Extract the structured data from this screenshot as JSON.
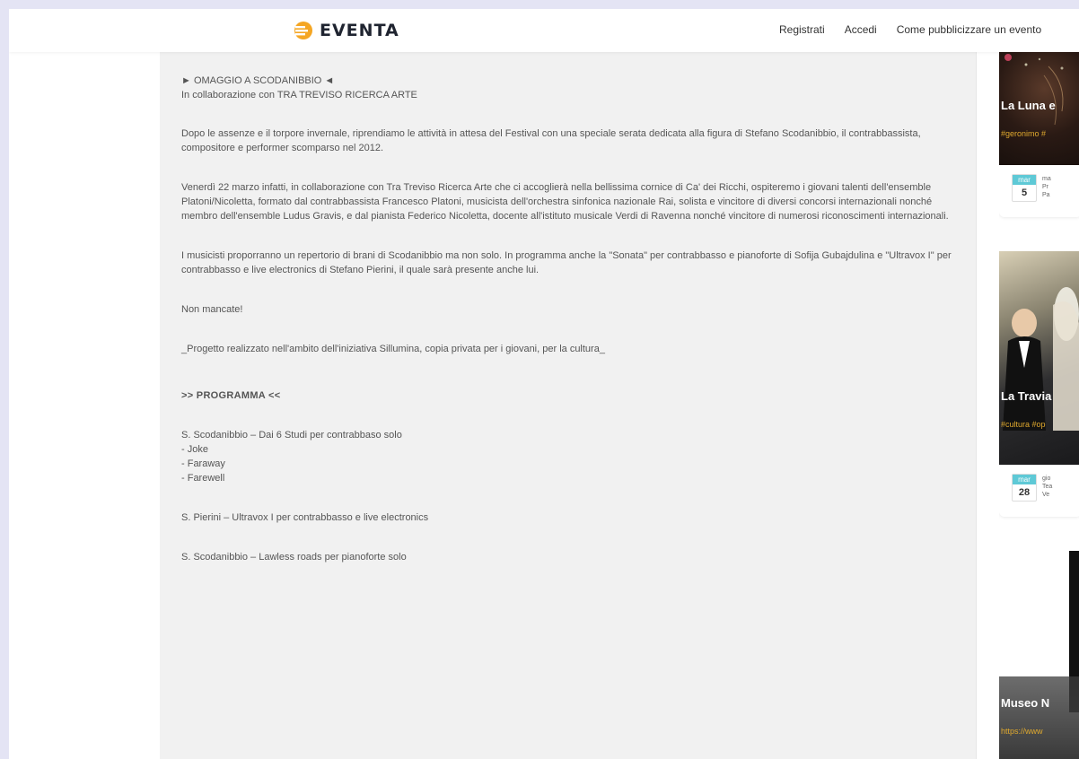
{
  "header": {
    "brand": "EVENTA",
    "nav": [
      "Registrati",
      "Accedi",
      "Come pubblicizzare un evento"
    ]
  },
  "article": {
    "title_line": "► OMAGGIO A SCODANIBBIO ◄",
    "collab_line": "In collaborazione con TRA TREVISO RICERCA ARTE",
    "para1": "Dopo le assenze e il torpore invernale, riprendiamo le attività in attesa del Festival con una speciale serata dedicata alla figura di Stefano Scodanibbio, il contrabbassista, compositore e performer scomparso nel 2012.",
    "para2": "Venerdì 22 marzo infatti, in collaborazione con Tra Treviso Ricerca Arte che ci accoglierà nella bellissima cornice di Ca' dei Ricchi, ospiteremo i giovani talenti dell'ensemble Platoni/Nicoletta, formato dal contrabbassista Francesco Platoni, musicista dell'orchestra sinfonica nazionale Rai, solista e vincitore di diversi concorsi internazionali nonché membro dell'ensemble Ludus Gravis, e dal pianista Federico Nicoletta, docente all'istituto musicale Verdi di Ravenna nonché vincitore di numerosi riconoscimenti internazionali.",
    "para3": "I musicisti proporranno un repertorio di brani di Scodanibbio ma non solo. In programma anche la \"Sonata\" per contrabbasso e pianoforte di Sofija Gubajdulina e \"Ultravox I\" per contrabbasso e live electronics di Stefano Pierini, il quale sarà presente anche lui.",
    "para4": "Non mancate!",
    "para5": "_Progetto realizzato nell'ambito dell'iniziativa Sillumina, copia privata per i giovani, per la cultura_",
    "program_head": ">> PROGRAMMA <<",
    "prog1_title": "S. Scodanibbio – Dai 6 Studi per contrabbaso solo",
    "prog1_items": [
      "- Joke",
      "- Faraway",
      "- Farewell"
    ],
    "prog2": "S. Pierini – Ultravox I per contrabbasso e live electronics",
    "prog3": "S. Scodanibbio – Lawless roads per pianoforte solo"
  },
  "sidebar": {
    "cards": [
      {
        "title": "La Luna e",
        "tags": "#geronimo #",
        "month": "mar",
        "day": "5",
        "info": [
          "ma",
          "Pr",
          "Pa"
        ]
      },
      {
        "title": "La Travia",
        "tags": "#cultura #op",
        "month": "mar",
        "day": "28",
        "info": [
          "gio",
          "Tea",
          "Ve"
        ]
      },
      {
        "title": "Museo N",
        "tags": "https://www"
      }
    ]
  },
  "colors": {
    "accent_orange": "#f5a623",
    "date_month_bg": "#5ec9d6",
    "tag_text": "#e0a92e"
  }
}
